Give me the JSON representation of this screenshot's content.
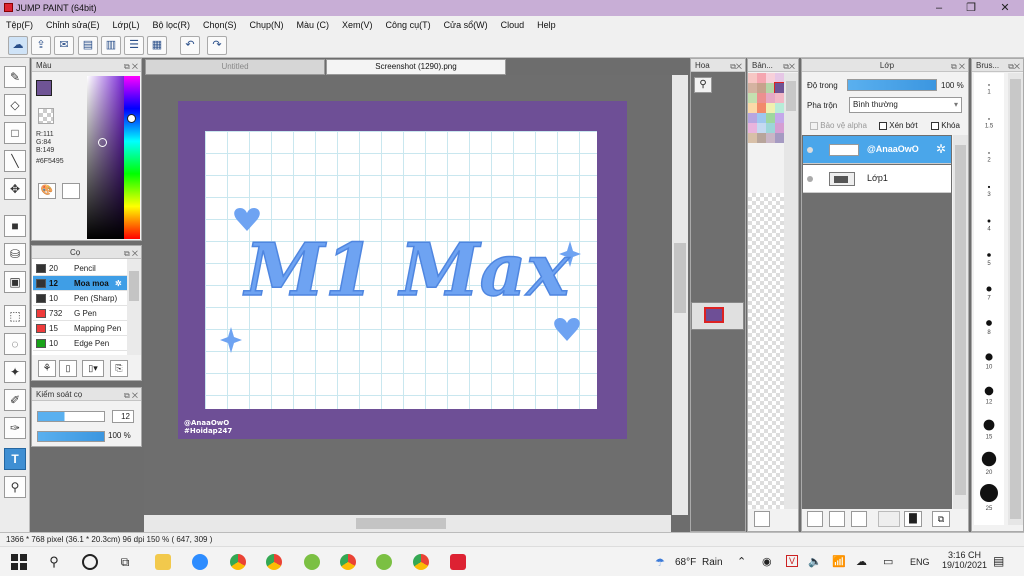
{
  "app": {
    "title": "JUMP PAINT (64bit)"
  },
  "menu": [
    "Tệp(F)",
    "Chỉnh sửa(E)",
    "Lớp(L)",
    "Bộ lọc(R)",
    "Chọn(S)",
    "Chụp(N)",
    "Màu (C)",
    "Xem(V)",
    "Công cụ(T)",
    "Cửa sổ(W)",
    "Cloud",
    "Help"
  ],
  "tabs": {
    "t1": "Untitled",
    "t2": "Screenshot (1290).png"
  },
  "color_panel": {
    "title": "Màu",
    "r": "R:111",
    "g": "G:84",
    "b": "B:149",
    "hex": "#6F5495",
    "current": "#6F5495"
  },
  "brush_panel": {
    "title": "Cọ",
    "items": [
      {
        "size": "20",
        "name": "Pencil",
        "color": "#333333"
      },
      {
        "size": "12",
        "name": "Moa moa",
        "color": "#333333"
      },
      {
        "size": "10",
        "name": "Pen (Sharp)",
        "color": "#333333"
      },
      {
        "size": "732",
        "name": "G Pen",
        "color": "#ef3b3b"
      },
      {
        "size": "15",
        "name": "Mapping Pen",
        "color": "#ef3b3b"
      },
      {
        "size": "10",
        "name": "Edge Pen",
        "color": "#19a319"
      }
    ]
  },
  "brush_control": {
    "title": "Kiểm soát cọ",
    "size": "12",
    "opacity": "100 %"
  },
  "canvas": {
    "artwork_text": "M1 Max",
    "watermark1": "@AnaaOwO",
    "watermark2": "#Hoidap247"
  },
  "nav_panel": {
    "title": "Hoa"
  },
  "palette_panel": {
    "title": "Bản..."
  },
  "layer_panel": {
    "title": "Lớp",
    "opacity_label": "Độ trong",
    "opacity_value": "100 %",
    "blend_label": "Pha trộn",
    "blend_value": "Bình thường",
    "protect_alpha": "Bảo vệ alpha",
    "clipping": "Xén bớt",
    "lock": "Khóa",
    "layers": [
      "@AnaaOwO",
      "Lớp1"
    ]
  },
  "brush_size_panel": {
    "title": "Brus...",
    "sizes": [
      "1",
      "1.5",
      "2",
      "3",
      "4",
      "5",
      "7",
      "8",
      "10",
      "12",
      "15",
      "20",
      "25"
    ]
  },
  "status": "1366 * 768 pixel   (36.1 * 20.3cm)   96 dpi   150 %   ( 647, 309 )",
  "taskbar": {
    "weather_temp": "68°F",
    "weather_text": "Rain",
    "lang": "ENG",
    "time": "3:16 CH",
    "date": "19/10/2021"
  }
}
